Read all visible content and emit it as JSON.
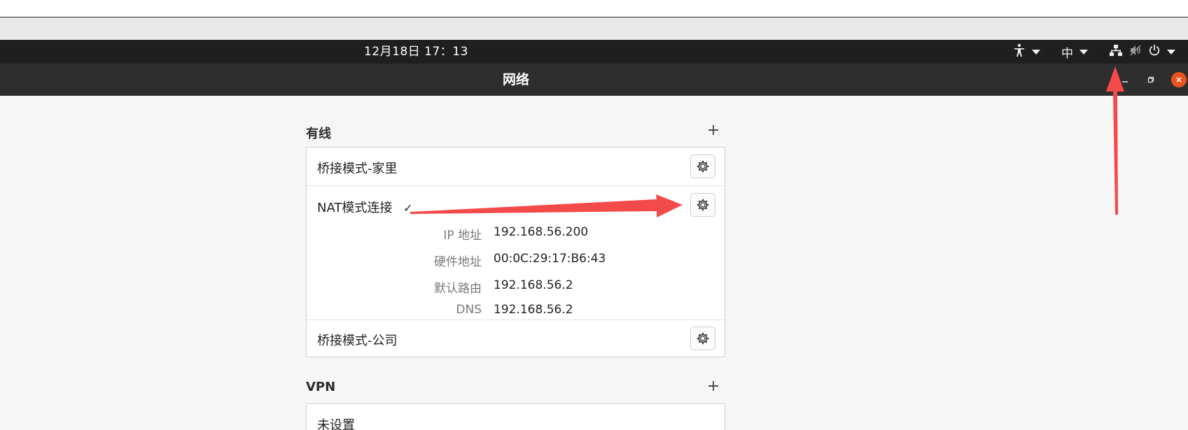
{
  "topbar": {
    "clock": "12月18日  17：13",
    "input_method": "中"
  },
  "window": {
    "title": "网络"
  },
  "wired": {
    "section_title": "有线",
    "add_symbol": "+",
    "connections": [
      {
        "name": "桥接模式-家里"
      },
      {
        "name": "NAT模式连接",
        "active_mark": "✓",
        "details": [
          {
            "label": "IP 地址",
            "value": "192.168.56.200"
          },
          {
            "label": "硬件地址",
            "value": "00:0C:29:17:B6:43"
          },
          {
            "label": "默认路由",
            "value": "192.168.56.2"
          },
          {
            "label": "DNS",
            "value": "192.168.56.2"
          }
        ]
      },
      {
        "name": "桥接模式-公司"
      }
    ]
  },
  "vpn": {
    "section_title": "VPN",
    "add_symbol": "+",
    "empty_label": "未设置"
  },
  "colors": {
    "annotation_arrow": "#f44a4a",
    "close_button": "#e95420",
    "topbar_bg": "#1f1f1f",
    "titlebar_bg": "#2e2e2e"
  }
}
